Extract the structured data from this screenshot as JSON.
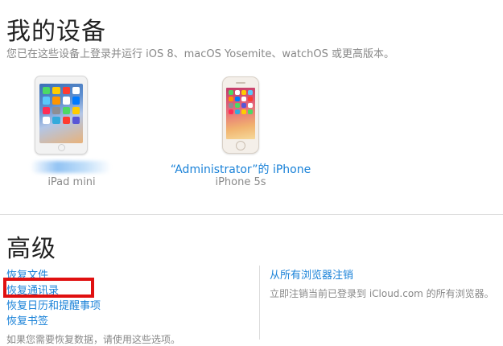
{
  "devices_section": {
    "title": "我的设备",
    "subtitle": "您已在这些设备上登录并运行 iOS 8、macOS Yosemite、watchOS 或更高版本。",
    "devices": [
      {
        "name": "",
        "model": "iPad mini"
      },
      {
        "name": "“Administrator”的 iPhone",
        "model": "iPhone 5s"
      }
    ]
  },
  "advanced_section": {
    "title": "高级",
    "links": [
      {
        "label": "恢复文件"
      },
      {
        "label": "恢复通讯录"
      },
      {
        "label": "恢复日历和提醒事项"
      },
      {
        "label": "恢复书签"
      }
    ],
    "note": "如果您需要恢复数据，请使用这些选项。",
    "signout": {
      "label": "从所有浏览器注销",
      "description": "立即注销当前已登录到 iCloud.com 的所有浏览器。"
    }
  },
  "colors": {
    "link": "#1a82d8",
    "highlight": "#e01010"
  }
}
